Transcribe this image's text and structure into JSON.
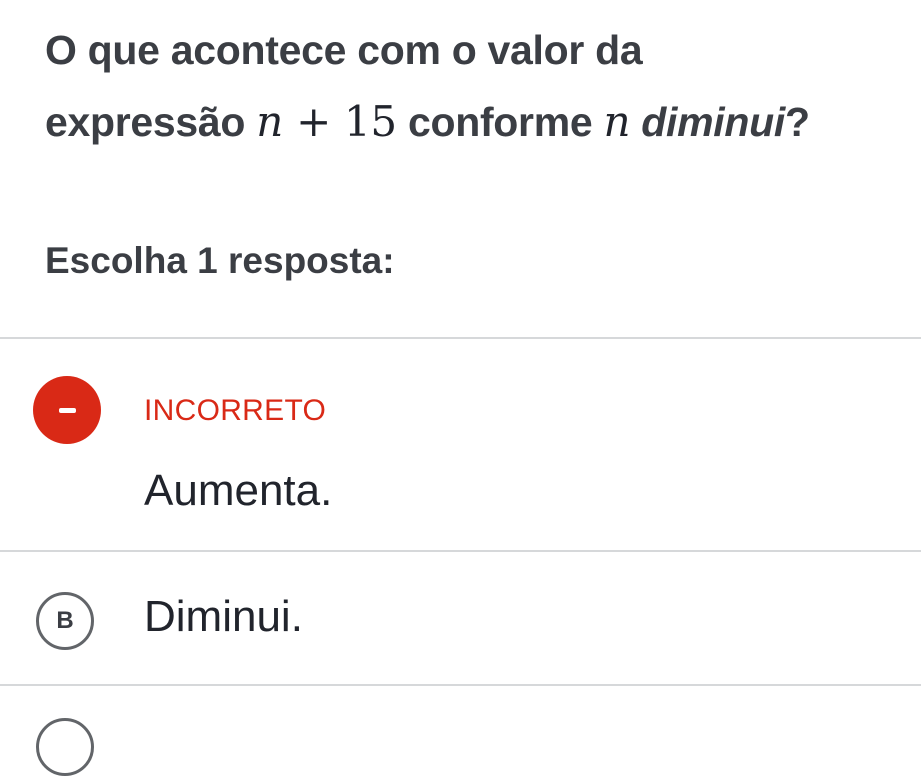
{
  "question": {
    "part1": "O que acontece com o valor da",
    "part2": "expressão",
    "math_var": "n",
    "math_op": " + ",
    "math_num": "15",
    "part3": "conforme",
    "math_var2": "n",
    "part4_italic": "diminui",
    "part5": "?"
  },
  "prompt": "Escolha 1 resposta:",
  "choices": [
    {
      "status": "INCORRETO",
      "text": "Aumenta.",
      "status_color": "#d92916",
      "status_icon": "minus-icon"
    },
    {
      "letter": "B",
      "text": "Diminui."
    }
  ],
  "colors": {
    "incorrect": "#d92916",
    "divider": "#d6d8da",
    "text": "#21242c"
  }
}
